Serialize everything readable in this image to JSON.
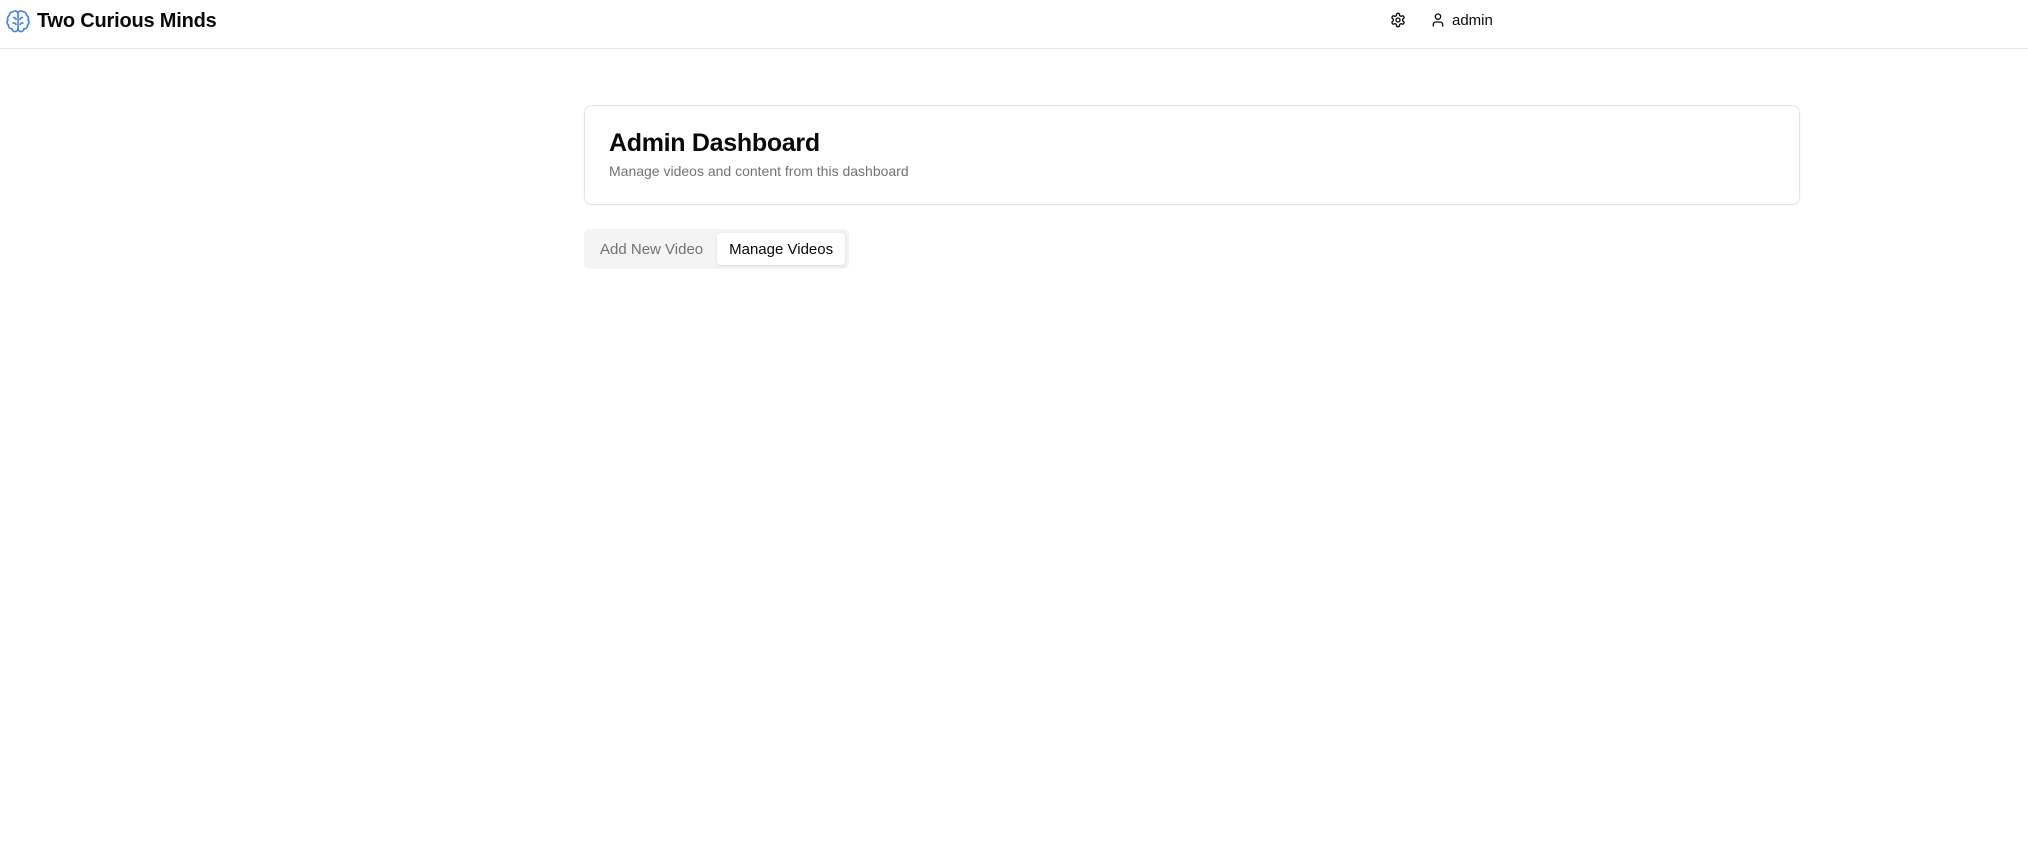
{
  "app": {
    "title": "Two Curious Minds",
    "logo_icon": "brain-icon",
    "accent_color": "#3b82f6"
  },
  "nav": {
    "settings_icon": "gear-icon",
    "user_icon": "user-icon",
    "user_label": "admin"
  },
  "header": {
    "title": "Admin Dashboard",
    "subtitle": "Manage videos and content from this dashboard"
  },
  "tabs": [
    {
      "label": "Add New Video",
      "active": false
    },
    {
      "label": "Manage Videos",
      "active": true
    }
  ]
}
